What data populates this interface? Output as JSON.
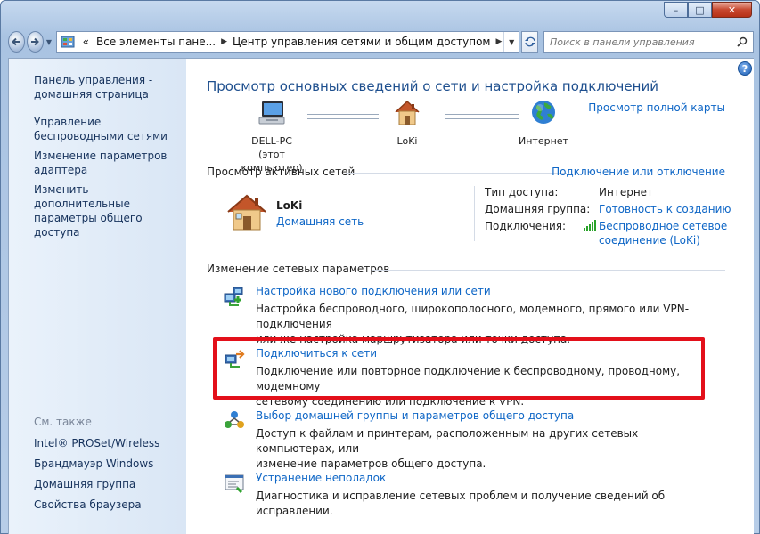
{
  "window": {
    "caption_buttons": [
      "minimize",
      "maximize",
      "close"
    ],
    "caption_glyphs": {
      "minimize": "–",
      "maximize": "□",
      "close": "✕"
    }
  },
  "navbar": {
    "address_segments": [
      "Все элементы пане...",
      "Центр управления сетями и общим доступом"
    ],
    "address_chevron": "«",
    "search_placeholder": "Поиск в панели управления"
  },
  "sidebar": {
    "links": [
      "Панель управления - домашняя страница",
      "Управление беспроводными сетями",
      "Изменение параметров адаптера",
      "Изменить дополнительные параметры общего доступа"
    ],
    "see_also_label": "См. также",
    "see_also_links": [
      "Intel® PROSet/Wireless",
      "Брандмауэр Windows",
      "Домашняя группа",
      "Свойства браузера"
    ]
  },
  "main": {
    "title": "Просмотр основных сведений о сети и настройка подключений",
    "full_map_link": "Просмотр полной карты",
    "map_nodes": [
      {
        "name": "DELL-PC",
        "sub": "(этот компьютер)",
        "icon": "computer-icon"
      },
      {
        "name": "LoKi",
        "sub": "",
        "icon": "house-icon"
      },
      {
        "name": "Интернет",
        "sub": "",
        "icon": "globe-icon"
      }
    ],
    "active_networks_title": "Просмотр активных сетей",
    "connect_disconnect_link": "Подключение или отключение",
    "network": {
      "name": "LoKi",
      "type": "Домашняя сеть",
      "access_type_label": "Тип доступа:",
      "access_type_value": "Интернет",
      "homegroup_label": "Домашняя группа:",
      "homegroup_value": "Готовность к созданию",
      "connections_label": "Подключения:",
      "connections_value_line1": "Беспроводное сетевое",
      "connections_value_line2": "соединение (LoKi)"
    },
    "change_settings_title": "Изменение сетевых параметров",
    "tasks": [
      {
        "title": "Настройка нового подключения или сети",
        "desc_line1": "Настройка беспроводного, широкополосного, модемного, прямого или VPN-подключения",
        "desc_line2": "или же настройка маршрутизатора или точки доступа."
      },
      {
        "title": "Подключиться к сети",
        "desc_line1": "Подключение или повторное подключение к беспроводному, проводному, модемному",
        "desc_line2": "сетевому соединению или подключение к VPN."
      },
      {
        "title": "Выбор домашней группы и параметров общего доступа",
        "desc_line1": "Доступ к файлам и принтерам, расположенным на других сетевых компьютерах, или",
        "desc_line2": "изменение параметров общего доступа."
      },
      {
        "title": "Устранение неполадок",
        "desc_line1": "Диагностика и исправление сетевых проблем и получение сведений об исправлении.",
        "desc_line2": ""
      }
    ]
  },
  "colors": {
    "link": "#0e66c6",
    "title": "#1e4f8e",
    "highlight": "#e3101a"
  }
}
